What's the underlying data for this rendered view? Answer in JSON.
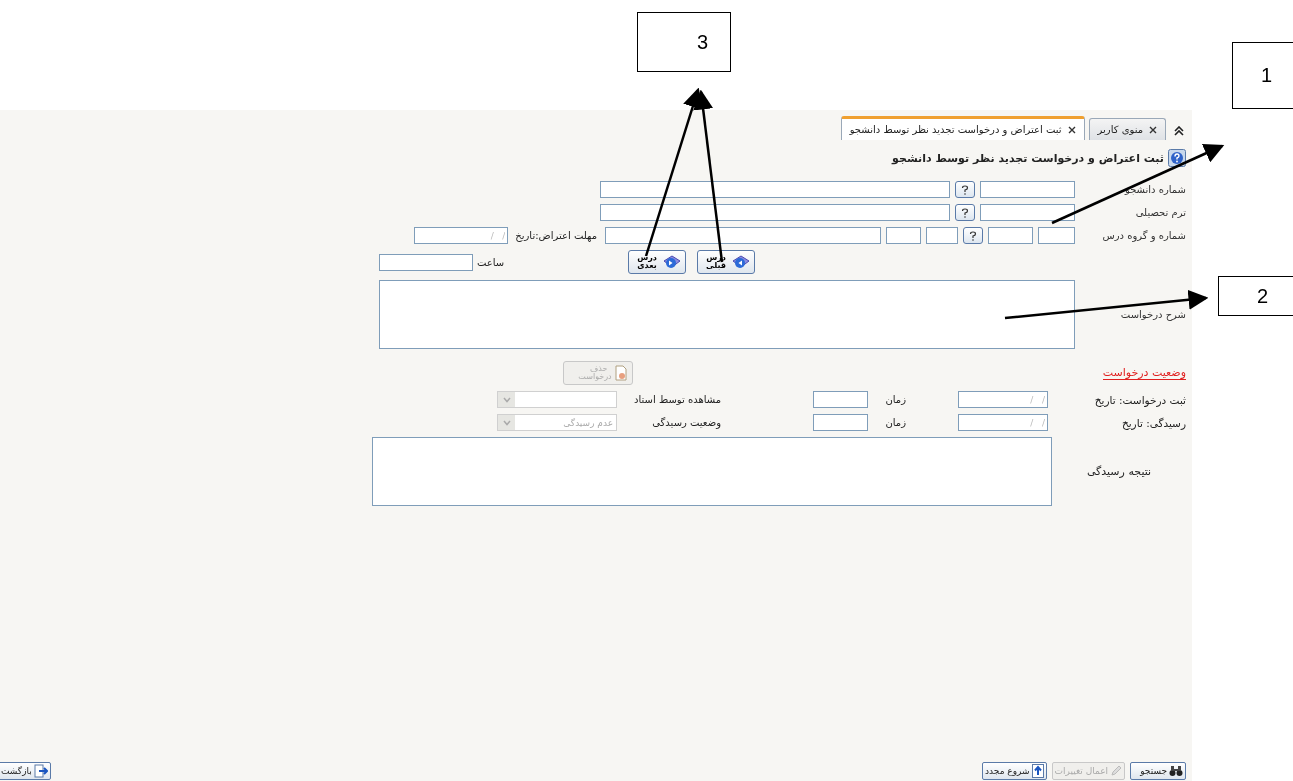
{
  "tabs": [
    {
      "label": "منوی کاربر",
      "selected": false
    },
    {
      "label": "ثبت اعتراض و درخواست تجدید نظر توسط دانشجو",
      "selected": true
    }
  ],
  "page_title": "ثبت اعتراض و درخواست تجدید نظر توسط دانشجو",
  "form": {
    "student_number_label": "شماره دانشجو",
    "term_label": "ترم تحصیلی",
    "course_label": "شماره و گروه درس",
    "deadline_label": "مهلت اعتراض:تاریخ",
    "deadline_placeholder": "/   /",
    "time_label": "ساعت",
    "prev_button": "درس قبلی",
    "next_button": "درس بعدی",
    "description_label": "شرح درخواست"
  },
  "status": {
    "heading": "وضعیت درخواست",
    "delete_button": {
      "label": "حذف درخواست",
      "disabled": true
    },
    "submitted_label": "ثبت درخواست: تاریخ",
    "submitted_placeholder": "/   /",
    "submitted_time_label": "زمان",
    "seen_label": "مشاهده توسط استاد",
    "seen_select": {
      "disabled": true
    },
    "reviewed_label": "رسیدگی: تاریخ",
    "reviewed_placeholder": "/   /",
    "reviewed_time_label": "زمان",
    "review_status_label": "وضعیت رسیدگی",
    "review_status_select": {
      "value": "عدم رسیدگی",
      "disabled": true
    },
    "result_label": "نتیجه رسیدگی"
  },
  "toolbar": [
    {
      "kind": "search",
      "label": "جستجو",
      "disabled": false
    },
    {
      "kind": "apply",
      "label": "اعمال تغییرات",
      "disabled": true
    },
    {
      "kind": "restart",
      "label": "شروع مجدد",
      "disabled": false
    }
  ],
  "back_button": "بازگشت",
  "annotations": [
    {
      "label": "3"
    },
    {
      "label": "1"
    },
    {
      "label": "2"
    }
  ]
}
